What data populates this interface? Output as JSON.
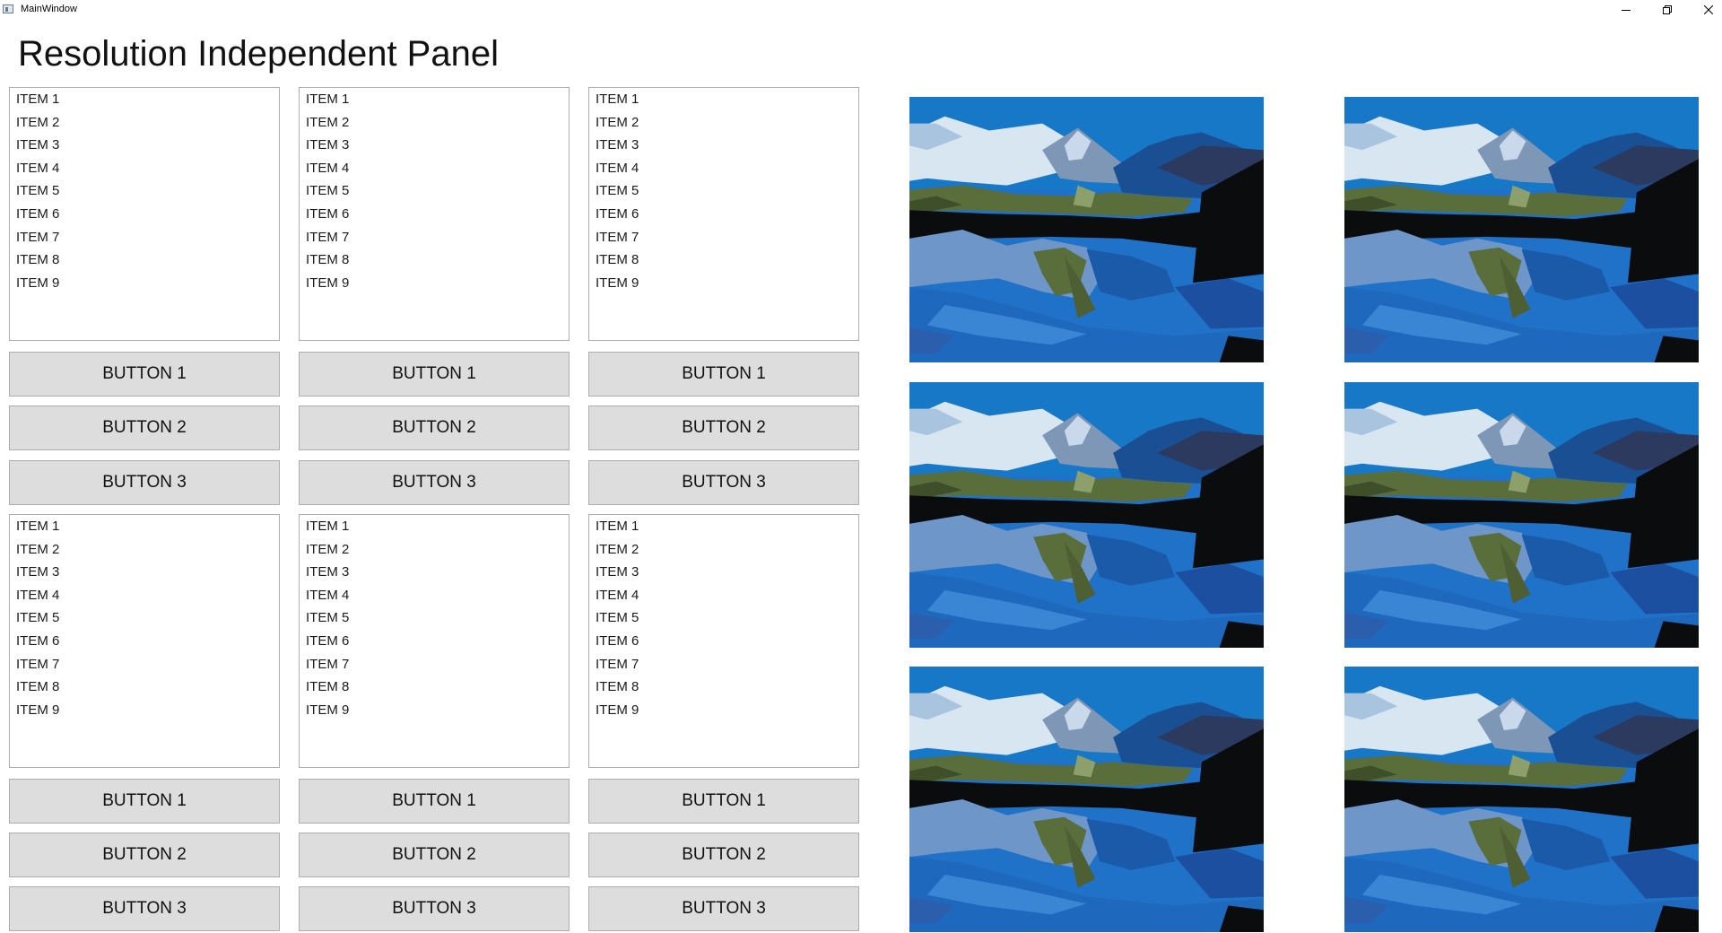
{
  "window": {
    "title": "MainWindow",
    "icons": [
      "app-window-icon",
      "minimize-icon",
      "restore-icon",
      "close-icon"
    ]
  },
  "heading": "Resolution Independent Panel",
  "panels": [
    {
      "items": [
        "ITEM 1",
        "ITEM 2",
        "ITEM 3",
        "ITEM 4",
        "ITEM 5",
        "ITEM 6",
        "ITEM 7",
        "ITEM 8",
        "ITEM 9"
      ],
      "buttons": [
        "BUTTON 1",
        "BUTTON 2",
        "BUTTON 3"
      ]
    },
    {
      "items": [
        "ITEM 1",
        "ITEM 2",
        "ITEM 3",
        "ITEM 4",
        "ITEM 5",
        "ITEM 6",
        "ITEM 7",
        "ITEM 8",
        "ITEM 9"
      ],
      "buttons": [
        "BUTTON 1",
        "BUTTON 2",
        "BUTTON 3"
      ]
    },
    {
      "items": [
        "ITEM 1",
        "ITEM 2",
        "ITEM 3",
        "ITEM 4",
        "ITEM 5",
        "ITEM 6",
        "ITEM 7",
        "ITEM 8",
        "ITEM 9"
      ],
      "buttons": [
        "BUTTON 1",
        "BUTTON 2",
        "BUTTON 3"
      ]
    },
    {
      "items": [
        "ITEM 1",
        "ITEM 2",
        "ITEM 3",
        "ITEM 4",
        "ITEM 5",
        "ITEM 6",
        "ITEM 7",
        "ITEM 8",
        "ITEM 9"
      ],
      "buttons": [
        "BUTTON 1",
        "BUTTON 2",
        "BUTTON 3"
      ]
    },
    {
      "items": [
        "ITEM 1",
        "ITEM 2",
        "ITEM 3",
        "ITEM 4",
        "ITEM 5",
        "ITEM 6",
        "ITEM 7",
        "ITEM 8",
        "ITEM 9"
      ],
      "buttons": [
        "BUTTON 1",
        "BUTTON 2",
        "BUTTON 3"
      ]
    },
    {
      "items": [
        "ITEM 1",
        "ITEM 2",
        "ITEM 3",
        "ITEM 4",
        "ITEM 5",
        "ITEM 6",
        "ITEM 7",
        "ITEM 8",
        "ITEM 9"
      ],
      "buttons": [
        "BUTTON 1",
        "BUTTON 2",
        "BUTTON 3"
      ]
    }
  ],
  "images": {
    "count": 6,
    "subject": "mountain-lake-reflection",
    "colors": {
      "sky": "#1878c8",
      "snow": "#d8e6f2",
      "forest": "#5a6e3c",
      "shadow": "#0b0c0e",
      "water": "#1f72c8"
    }
  }
}
